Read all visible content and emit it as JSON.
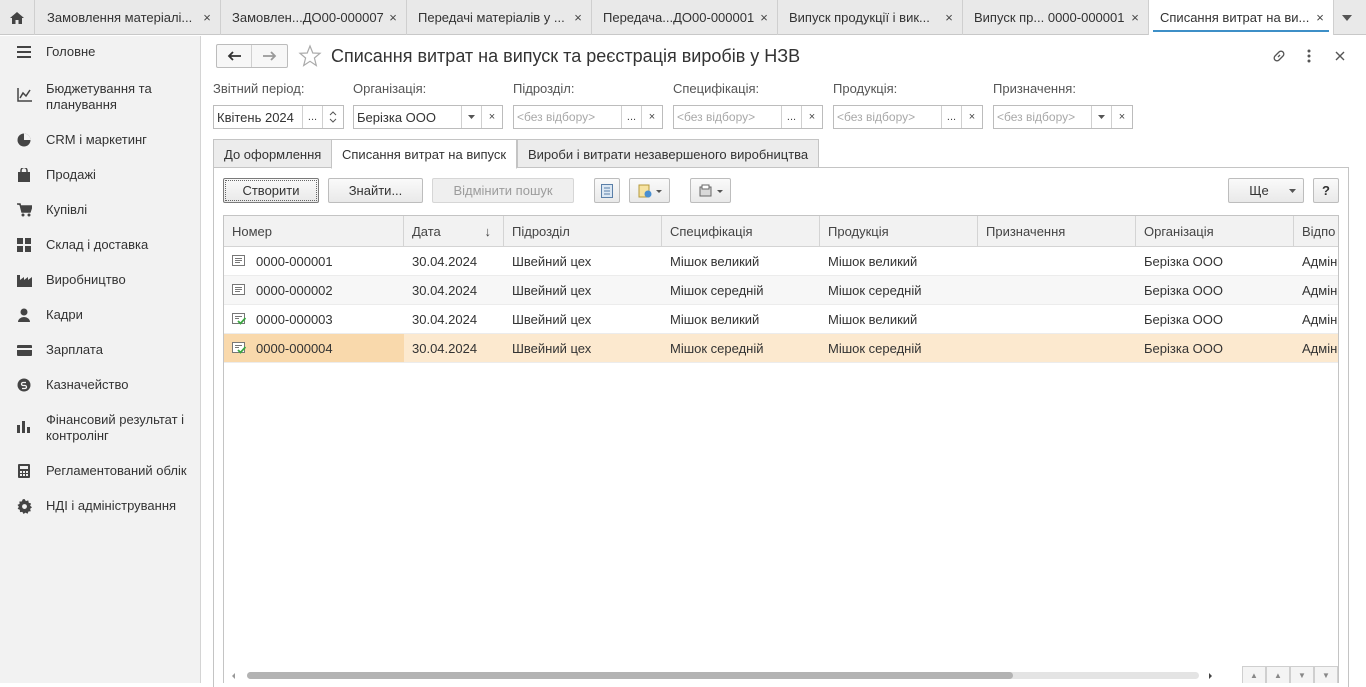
{
  "top_tabs": [
    {
      "label": "Замовлення матеріалі...",
      "close": "×"
    },
    {
      "label": "Замовлен...ДО00-000007",
      "close": "×"
    },
    {
      "label": "Передачі матеріалів у ...",
      "close": "×"
    },
    {
      "label": "Передача...ДО00-000001",
      "close": "×"
    },
    {
      "label": "Випуск продукції і вик...",
      "close": "×"
    },
    {
      "label": "Випуск пр... 0000-000001",
      "close": "×"
    },
    {
      "label": "Списання витрат на ви...",
      "close": "×"
    }
  ],
  "sidebar": {
    "items": [
      {
        "label": "Головне",
        "icon": "menu-icon"
      },
      {
        "label": "Бюджетування та планування",
        "icon": "chart-line-icon"
      },
      {
        "label": "CRM і маркетинг",
        "icon": "pie-chart-icon"
      },
      {
        "label": "Продажі",
        "icon": "shopping-bag-icon"
      },
      {
        "label": "Купівлі",
        "icon": "cart-icon"
      },
      {
        "label": "Склад і доставка",
        "icon": "warehouse-grid-icon"
      },
      {
        "label": "Виробництво",
        "icon": "factory-icon"
      },
      {
        "label": "Кадри",
        "icon": "person-icon"
      },
      {
        "label": "Зарплата",
        "icon": "card-icon"
      },
      {
        "label": "Казначейство",
        "icon": "coin-icon"
      },
      {
        "label": "Фінансовий результат і контролінг",
        "icon": "bar-chart-icon"
      },
      {
        "label": "Регламентований облік",
        "icon": "calculator-icon"
      },
      {
        "label": "НДІ і адміністрування",
        "icon": "gear-icon"
      }
    ]
  },
  "header": {
    "title": "Списання витрат на випуск та реєстрація виробів у НЗВ"
  },
  "filters": {
    "period": {
      "label": "Звітний період:",
      "value": "Квітень 2024",
      "dots": "..."
    },
    "organization": {
      "label": "Організація:",
      "value": "Берізка ООО"
    },
    "department": {
      "label": "Підрозділ:",
      "placeholder": "<без відбору>",
      "dots": "..."
    },
    "specification": {
      "label": "Специфікація:",
      "placeholder": "<без відбору>",
      "dots": "..."
    },
    "product": {
      "label": "Продукція:",
      "placeholder": "<без відбору>",
      "dots": "..."
    },
    "purpose": {
      "label": "Призначення:",
      "placeholder": "<без відбору>"
    }
  },
  "page_tabs": [
    {
      "label": "До оформлення"
    },
    {
      "label": "Списання витрат на випуск"
    },
    {
      "label": "Вироби і витрати незавершеного виробництва"
    }
  ],
  "toolbar": {
    "create": "Створити",
    "find": "Знайти...",
    "cancel_search": "Відмінити пошук",
    "more": "Ще",
    "help": "?"
  },
  "table": {
    "columns": [
      "Номер",
      "Дата",
      "Підрозділ",
      "Специфікація",
      "Продукція",
      "Призначення",
      "Організація",
      "Відпо"
    ],
    "sort_indicator": "↓",
    "rows": [
      {
        "number": "0000-000001",
        "date": "30.04.2024",
        "department": "Швейний цех",
        "spec": "Мішок великий",
        "product": "Мішок великий",
        "purpose": "",
        "org": "Берізка ООО",
        "resp": "Адмін",
        "posted": false
      },
      {
        "number": "0000-000002",
        "date": "30.04.2024",
        "department": "Швейний цех",
        "spec": "Мішок середній",
        "product": "Мішок середній",
        "purpose": "",
        "org": "Берізка ООО",
        "resp": "Адмін",
        "posted": false
      },
      {
        "number": "0000-000003",
        "date": "30.04.2024",
        "department": "Швейний цех",
        "spec": "Мішок великий",
        "product": "Мішок великий",
        "purpose": "",
        "org": "Берізка ООО",
        "resp": "Адмін",
        "posted": true
      },
      {
        "number": "0000-000004",
        "date": "30.04.2024",
        "department": "Швейний цех",
        "spec": "Мішок середній",
        "product": "Мішок середній",
        "purpose": "",
        "org": "Берізка ООО",
        "resp": "Адмін",
        "posted": true
      }
    ],
    "selected_row": 3
  },
  "colors": {
    "accent": "#3d8fc7",
    "selected_row": "#fce9cf",
    "selected_cell": "#f9d9ac",
    "posted_check": "#3aa640"
  }
}
